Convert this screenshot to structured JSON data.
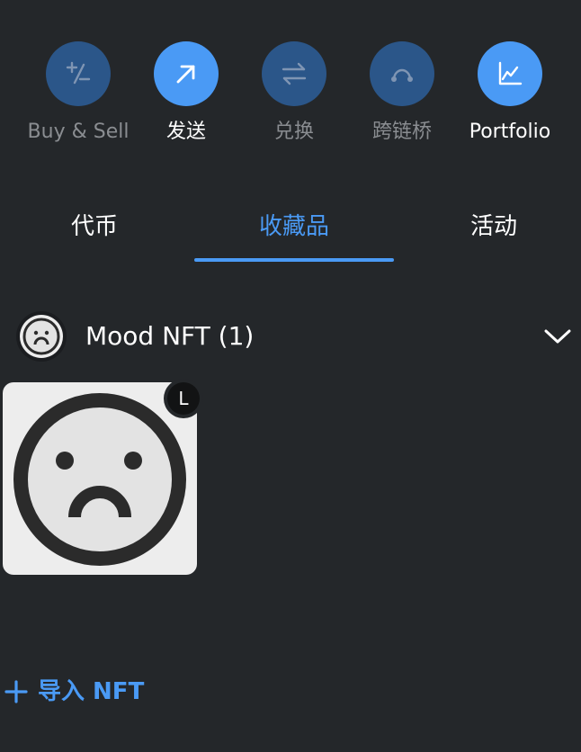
{
  "actions": [
    {
      "label": "Buy & Sell",
      "icon": "buy-sell-icon",
      "state": "disabled"
    },
    {
      "label": "发送",
      "icon": "send-arrow-icon",
      "state": "active"
    },
    {
      "label": "兑换",
      "icon": "swap-arrows-icon",
      "state": "disabled"
    },
    {
      "label": "跨链桥",
      "icon": "bridge-icon",
      "state": "disabled"
    },
    {
      "label": "Portfolio",
      "icon": "portfolio-chart-icon",
      "state": "active"
    }
  ],
  "tabs": [
    {
      "label": "代币",
      "active": false
    },
    {
      "label": "收藏品",
      "active": true
    },
    {
      "label": "活动",
      "active": false
    }
  ],
  "collection": {
    "title": "Mood NFT (1)",
    "icon": "sad-face-icon",
    "expand_icon": "chevron-down-icon"
  },
  "nft": {
    "image": "sad-face-icon",
    "network_badge": "L"
  },
  "import": {
    "label": "导入 NFT",
    "icon": "plus-icon"
  },
  "colors": {
    "background": "#24272a",
    "accent": "#4a9af5",
    "disabled_circle": "#2b5689",
    "disabled_text": "#8a8d91"
  }
}
